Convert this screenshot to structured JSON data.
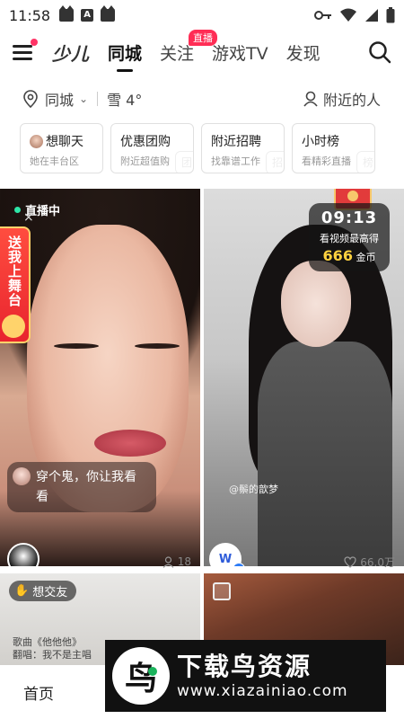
{
  "status_bar": {
    "time": "11:58"
  },
  "top_nav": {
    "logo": "少儿",
    "tabs": [
      {
        "label": "同城",
        "active": true
      },
      {
        "label": "关注",
        "badge": "直播"
      },
      {
        "label": "游戏TV"
      },
      {
        "label": "发现"
      }
    ]
  },
  "location": {
    "city": "同城",
    "weather": "雪 4°",
    "nearby": "附近的人"
  },
  "cards": [
    {
      "title": "想聊天",
      "sub": "她在丰台区"
    },
    {
      "title": "优惠团购",
      "sub": "附近超值购"
    },
    {
      "title": "附近招聘",
      "sub": "找靠谱工作"
    },
    {
      "title": "小时榜",
      "sub": "看精彩直播"
    }
  ],
  "feed": {
    "tile_a": {
      "live_label": "直播中",
      "stage_banner": "送我上舞台",
      "comment": "穿个鬼，你让我看看",
      "viewers": "18"
    },
    "tile_b": {
      "timer": "09:13",
      "timer_sub": "看视频最高得",
      "coins": "666",
      "coins_unit": "金币",
      "watermark": "@鬃的歆梦",
      "author_logo": "W",
      "likes": "66.0万"
    },
    "tile_c": {
      "tag": "想交友",
      "line1": "歌曲《他他他》",
      "line2": "翻唱：我不是主唱"
    }
  },
  "bottom_bar": {
    "home": "首页"
  },
  "download_banner": {
    "logo": "鸟",
    "title": "下载鸟资源",
    "url": "www.xiazainiao.com"
  },
  "colors": {
    "accent": "#ff2d55",
    "live_dot": "#2ee6a8",
    "coin": "#ffd23f"
  }
}
